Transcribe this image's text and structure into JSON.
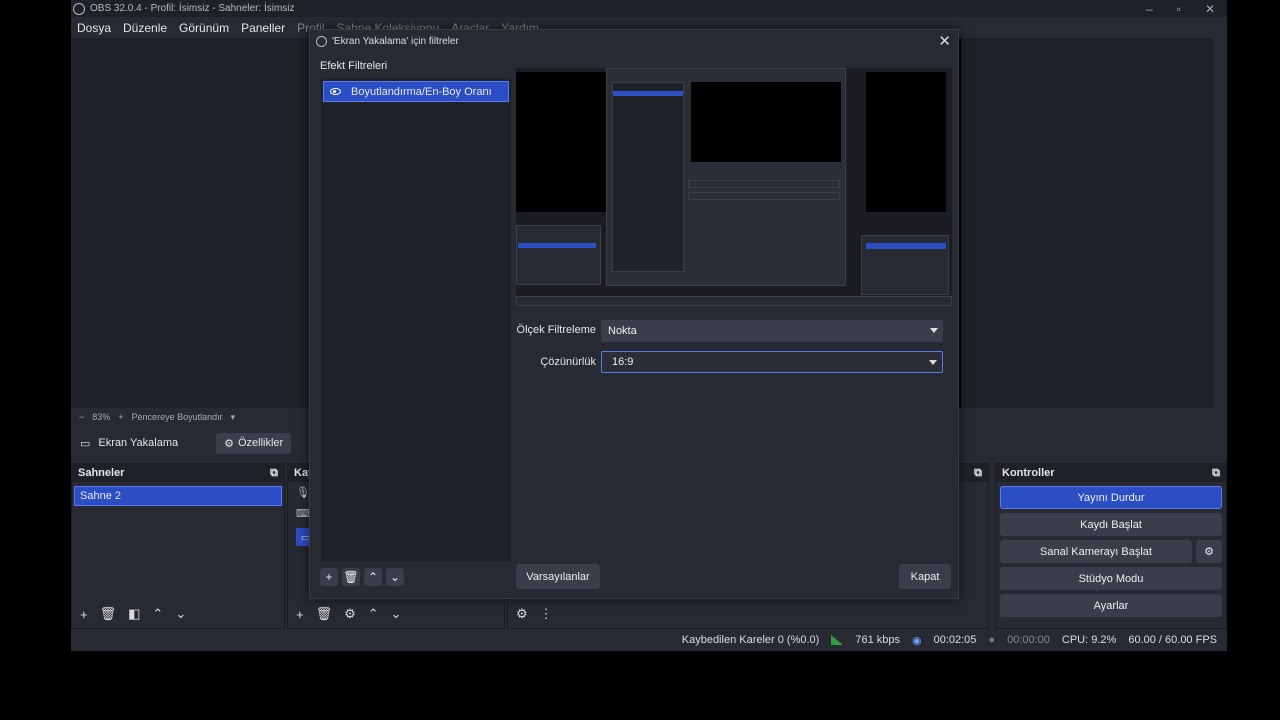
{
  "app": {
    "title": "OBS 32.0.4 - Profil: İsimsiz - Sahneler: İsimsiz",
    "menu": [
      "Dosya",
      "Düzenle",
      "Görünüm",
      "Paneller",
      "Profil",
      "Sahne Koleksiyonu",
      "Araçlar",
      "Yardım"
    ]
  },
  "zoom": {
    "minus": "−",
    "value": "83%",
    "plus": "+",
    "mode": "Pencereye Boyutlandır"
  },
  "source_bar": {
    "name": "Ekran Yakalama",
    "properties": "Özellikler"
  },
  "scenes": {
    "title": "Sahneler",
    "items": [
      "Sahne 2"
    ]
  },
  "sources": {
    "title": "Kay"
  },
  "controls": {
    "title": "Kontroller",
    "stop_stream": "Yayını Durdur",
    "start_record": "Kaydı Başlat",
    "virtual_cam": "Sanal Kamerayı Başlat",
    "studio_mode": "Stüdyo Modu",
    "settings": "Ayarlar"
  },
  "status": {
    "dropped": "Kaybedilen Kareler 0 (%0.0)",
    "bitrate": "761 kbps",
    "stream_time": "00:02:05",
    "record_time": "00:00:00",
    "cpu": "CPU: 9.2%",
    "fps": "60.00 / 60.00 FPS"
  },
  "dialog": {
    "title": "'Ekran Yakalama' için filtreler",
    "filters_label": "Efekt Filtreleri",
    "filters": [
      "Boyutlandırma/En-Boy Oranı"
    ],
    "scale_filter_label": "Ölçek Filtreleme",
    "scale_filter_value": "Nokta",
    "resolution_label": "Çözünürlük",
    "resolution_value": "16:9",
    "defaults_button": "Varsayılanlar",
    "close_button": "Kapat"
  },
  "colors": {
    "accent": "#2c4ec5",
    "panel": "#272a33",
    "dark": "#1f2128"
  }
}
